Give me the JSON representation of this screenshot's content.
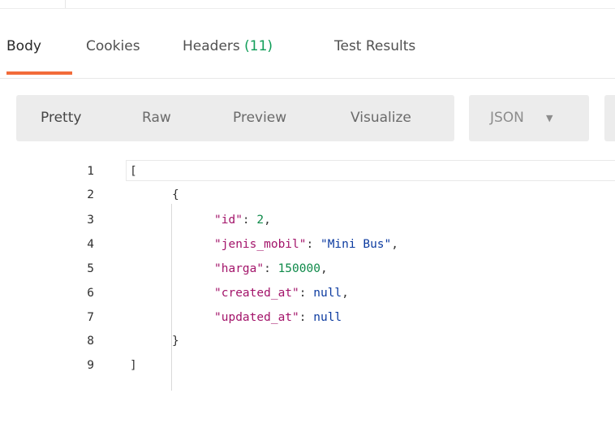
{
  "tabs": [
    {
      "label": "Body",
      "active": true
    },
    {
      "label": "Cookies",
      "active": false
    },
    {
      "label": "Headers",
      "count": "(11)",
      "active": false
    },
    {
      "label": "Test Results",
      "active": false
    }
  ],
  "toolbar": {
    "buttons": [
      "Pretty",
      "Raw",
      "Preview",
      "Visualize"
    ],
    "selected": "Pretty",
    "format_value": "JSON",
    "format_caret": "▼"
  },
  "editor": {
    "line_numbers": [
      "1",
      "2",
      "3",
      "4",
      "5",
      "6",
      "7",
      "8",
      "9"
    ],
    "lines": {
      "l1": "[",
      "l2": "{",
      "l3": {
        "key": "\"id\"",
        "value": "2"
      },
      "l4": {
        "key": "\"jenis_mobil\"",
        "value": "\"Mini Bus\""
      },
      "l5": {
        "key": "\"harga\"",
        "value": "150000"
      },
      "l6": {
        "key": "\"created_at\"",
        "value": "null"
      },
      "l7": {
        "key": "\"updated_at\"",
        "value": "null"
      },
      "l8": "}",
      "l9": "]"
    }
  },
  "colors": {
    "active_tab_underline": "#f26b3a",
    "headers_count": "#0f9d58",
    "json_key": "#a3146a",
    "json_string": "#0c3ba0",
    "json_number": "#0f8a4a"
  }
}
